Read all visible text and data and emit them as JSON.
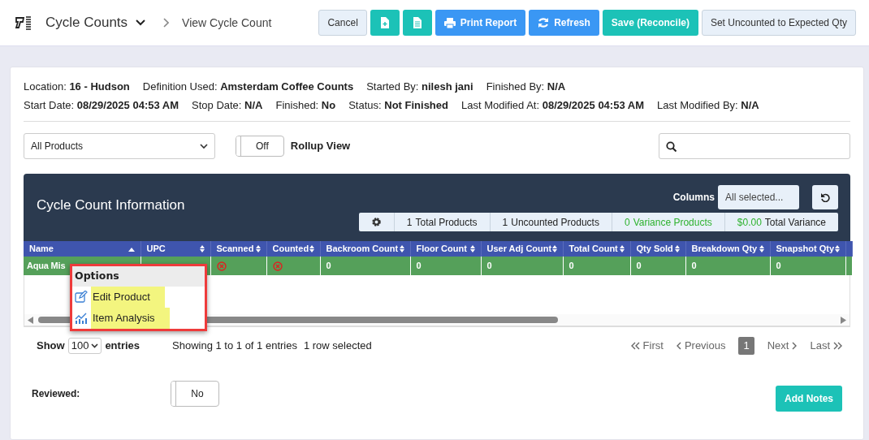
{
  "header": {
    "app_title": "Cycle Counts",
    "breadcrumb": "View Cycle Count",
    "buttons": [
      {
        "label": "Cancel",
        "kind": "plain"
      },
      {
        "kind": "new-file"
      },
      {
        "kind": "document"
      },
      {
        "label": "Print Report",
        "kind": "print"
      },
      {
        "label": "Refresh",
        "kind": "refresh"
      },
      {
        "label": "Save (Reconcile)",
        "kind": "save"
      },
      {
        "label": "Set Uncounted to Expected Qty",
        "kind": "plain"
      }
    ]
  },
  "info_lines": [
    [
      {
        "label": "Location:",
        "value": "16 - Hudson"
      },
      {
        "label": "Definition Used:",
        "value": "Amsterdam Coffee Counts"
      },
      {
        "label": "Started By:",
        "value": "nilesh jani"
      },
      {
        "label": "Finished By:",
        "value": "N/A"
      }
    ],
    [
      {
        "label": "Start Date:",
        "value": "08/29/2025 04:53 AM"
      },
      {
        "label": "Stop Date:",
        "value": "N/A"
      },
      {
        "label": "Finished:",
        "value": "No"
      },
      {
        "label": "Status:",
        "value": "Not Finished"
      },
      {
        "label": "Last Modified At:",
        "value": "08/29/2025 04:53 AM"
      },
      {
        "label": "Last Modified By:",
        "value": "N/A"
      }
    ]
  ],
  "filters": {
    "product_select": "All Products",
    "rollup_toggle": {
      "label": "Off",
      "on": false
    },
    "rollup_label": "Rollup View"
  },
  "panel": {
    "title": "Cycle Count Information",
    "columns_label": "Columns",
    "columns_select": "All selected...",
    "stats": [
      {
        "value": "1",
        "label": "Total Products",
        "kind": "count"
      },
      {
        "value": "1",
        "label": "Uncounted Products",
        "kind": "count"
      },
      {
        "value": "0",
        "label": "Variance Products",
        "kind": "variance"
      },
      {
        "value": "$0.00",
        "label": "Total Variance",
        "kind": "money"
      }
    ]
  },
  "table": {
    "columns": [
      {
        "label": "Name",
        "sorted": true
      },
      {
        "label": "UPC",
        "sorted": false
      },
      {
        "label": "Scanned",
        "sorted": false
      },
      {
        "label": "Counted",
        "sorted": false
      },
      {
        "label": "Backroom Count",
        "sorted": false
      },
      {
        "label": "Floor Count",
        "sorted": false
      },
      {
        "label": "User Adj Count",
        "sorted": false
      },
      {
        "label": "Total Count",
        "sorted": false
      },
      {
        "label": "Qty Sold",
        "sorted": false
      },
      {
        "label": "Breakdown Qty",
        "sorted": false
      },
      {
        "label": "Snapshot Qty",
        "sorted": false
      }
    ],
    "rows": [
      {
        "name": "Aqua Mis",
        "scanned": false,
        "counted": false,
        "values": [
          "0",
          "0",
          "0",
          "0",
          "0",
          "0",
          "0"
        ],
        "selected": true
      }
    ]
  },
  "context_menu": {
    "title": "Options",
    "items": [
      {
        "label": "Edit Product",
        "kind": "edit",
        "highlighted": true
      },
      {
        "label": "Item Analysis",
        "kind": "analysis",
        "highlighted": true
      }
    ]
  },
  "footer": {
    "show_label": "Show",
    "page_size": "100",
    "entries_label": "entries",
    "info": "Showing 1 to 1 of 1 entries",
    "selection_info": "1 row selected",
    "pagination": [
      {
        "label": "First",
        "kind": "first",
        "selected": false
      },
      {
        "label": "Previous",
        "kind": "previous",
        "selected": false
      },
      {
        "label": "1",
        "kind": "page",
        "selected": true
      },
      {
        "label": "Next",
        "kind": "next",
        "selected": false
      },
      {
        "label": "Last",
        "kind": "last",
        "selected": false
      }
    ]
  },
  "reviewed": {
    "label": "Reviewed:",
    "toggle": {
      "label": "No",
      "on": false
    }
  },
  "add_notes": "Add Notes"
}
